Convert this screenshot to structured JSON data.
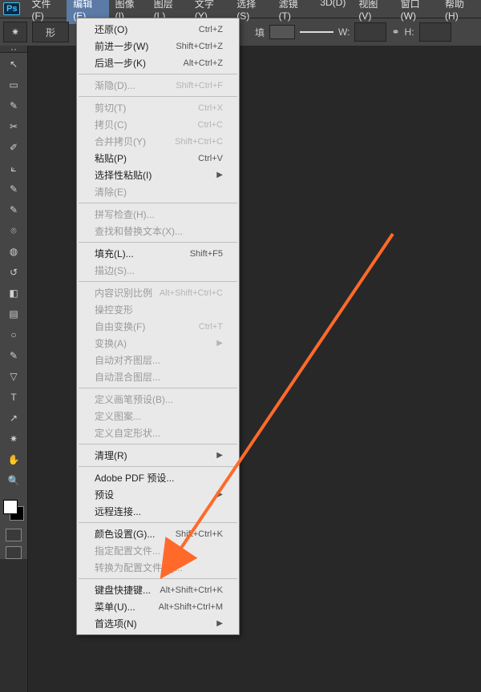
{
  "app_logo": "Ps",
  "menubar": {
    "items": [
      "文件(F)",
      "编辑(E)",
      "图像(I)",
      "图层(L)",
      "文字(Y)",
      "选择(S)",
      "滤镜(T)",
      "3D(D)",
      "视图(V)",
      "窗口(W)",
      "帮助(H)"
    ],
    "active_index": 1
  },
  "optionsbar": {
    "shape_label": "形",
    "fill_label": "填",
    "w_label": "W:",
    "h_label": "H:"
  },
  "toolbox": {
    "tools": [
      "↖",
      "▭",
      "✎",
      "✂",
      "✐",
      "⟀",
      "✎",
      "✎",
      "⌾",
      "◍",
      "↺",
      "◧",
      "▤",
      "○",
      "✎",
      "▽",
      "T",
      "↗",
      "✷",
      "✋",
      "🔍"
    ]
  },
  "edit_menu": {
    "groups": [
      [
        {
          "label": "还原(O)",
          "shortcut": "Ctrl+Z",
          "enabled": true
        },
        {
          "label": "前进一步(W)",
          "shortcut": "Shift+Ctrl+Z",
          "enabled": true
        },
        {
          "label": "后退一步(K)",
          "shortcut": "Alt+Ctrl+Z",
          "enabled": true
        }
      ],
      [
        {
          "label": "渐隐(D)...",
          "shortcut": "Shift+Ctrl+F",
          "enabled": false
        }
      ],
      [
        {
          "label": "剪切(T)",
          "shortcut": "Ctrl+X",
          "enabled": false
        },
        {
          "label": "拷贝(C)",
          "shortcut": "Ctrl+C",
          "enabled": false
        },
        {
          "label": "合并拷贝(Y)",
          "shortcut": "Shift+Ctrl+C",
          "enabled": false
        },
        {
          "label": "粘贴(P)",
          "shortcut": "Ctrl+V",
          "enabled": true
        },
        {
          "label": "选择性粘贴(I)",
          "shortcut": "",
          "submenu": true,
          "enabled": true
        },
        {
          "label": "清除(E)",
          "shortcut": "",
          "enabled": false
        }
      ],
      [
        {
          "label": "拼写检查(H)...",
          "shortcut": "",
          "enabled": false
        },
        {
          "label": "查找和替换文本(X)...",
          "shortcut": "",
          "enabled": false
        }
      ],
      [
        {
          "label": "填充(L)...",
          "shortcut": "Shift+F5",
          "enabled": true
        },
        {
          "label": "描边(S)...",
          "shortcut": "",
          "enabled": false
        }
      ],
      [
        {
          "label": "内容识别比例",
          "shortcut": "Alt+Shift+Ctrl+C",
          "enabled": false
        },
        {
          "label": "操控变形",
          "shortcut": "",
          "enabled": false
        },
        {
          "label": "自由变换(F)",
          "shortcut": "Ctrl+T",
          "enabled": false
        },
        {
          "label": "变换(A)",
          "shortcut": "",
          "submenu": true,
          "enabled": false
        },
        {
          "label": "自动对齐图层...",
          "shortcut": "",
          "enabled": false
        },
        {
          "label": "自动混合图层...",
          "shortcut": "",
          "enabled": false
        }
      ],
      [
        {
          "label": "定义画笔预设(B)...",
          "shortcut": "",
          "enabled": false
        },
        {
          "label": "定义图案...",
          "shortcut": "",
          "enabled": false
        },
        {
          "label": "定义自定形状...",
          "shortcut": "",
          "enabled": false
        }
      ],
      [
        {
          "label": "清理(R)",
          "shortcut": "",
          "submenu": true,
          "enabled": true
        }
      ],
      [
        {
          "label": "Adobe PDF 预设...",
          "shortcut": "",
          "enabled": true
        },
        {
          "label": "预设",
          "shortcut": "",
          "submenu": true,
          "enabled": true
        },
        {
          "label": "远程连接...",
          "shortcut": "",
          "enabled": true
        }
      ],
      [
        {
          "label": "颜色设置(G)...",
          "shortcut": "Shift+Ctrl+K",
          "enabled": true
        },
        {
          "label": "指定配置文件...",
          "shortcut": "",
          "enabled": false
        },
        {
          "label": "转换为配置文件(V)...",
          "shortcut": "",
          "enabled": false
        }
      ],
      [
        {
          "label": "键盘快捷键...",
          "shortcut": "Alt+Shift+Ctrl+K",
          "enabled": true
        },
        {
          "label": "菜单(U)...",
          "shortcut": "Alt+Shift+Ctrl+M",
          "enabled": true
        },
        {
          "label": "首选项(N)",
          "shortcut": "",
          "submenu": true,
          "enabled": true
        }
      ]
    ]
  }
}
